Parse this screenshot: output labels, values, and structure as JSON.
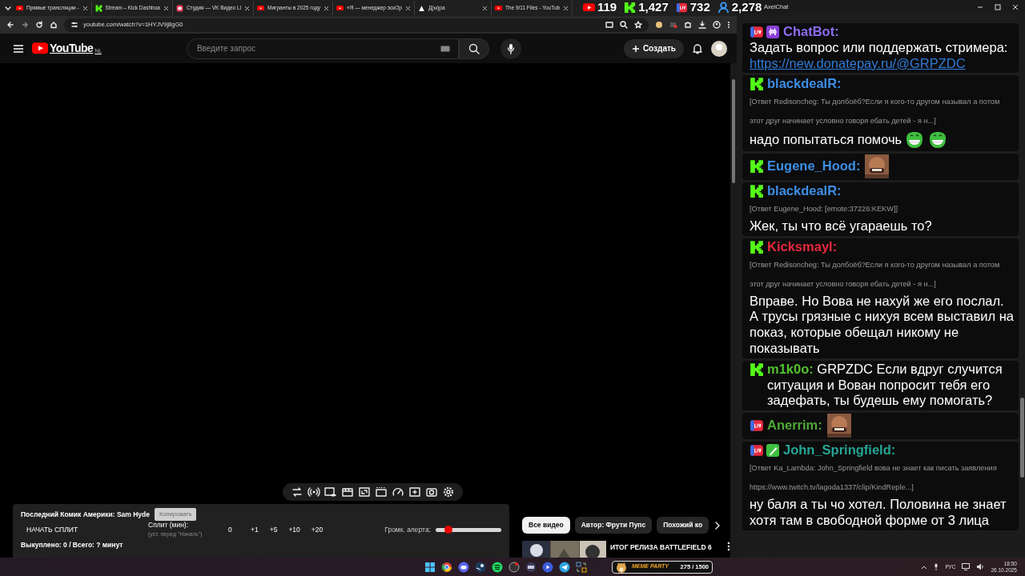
{
  "browser": {
    "tabs": [
      {
        "title": "Прямые трансляции -",
        "kind": "youtube"
      },
      {
        "title": "Stream – Kick Dashboa",
        "kind": "kick"
      },
      {
        "title": "Студия — VK Видео Li",
        "kind": "vk"
      },
      {
        "title": "Мигранты в 2025 году",
        "kind": "youtube"
      },
      {
        "title": "«Я — менеджер эскОр",
        "kind": "youtube"
      },
      {
        "title": "Д(ы)ра",
        "kind": "triangle"
      },
      {
        "title": "The 9/11 Files - YouTub",
        "kind": "youtube"
      }
    ],
    "address": "youtube.com/watch?v=1HYJV9j8gG0"
  },
  "stream_counters": [
    {
      "kind": "youtube",
      "value": "119"
    },
    {
      "kind": "kick",
      "value": "1,427"
    },
    {
      "kind": "live",
      "value": "732"
    },
    {
      "kind": "viewers",
      "value": "2,278"
    }
  ],
  "youtube": {
    "logo": "YouTube",
    "region": "NL",
    "search_placeholder": "Введите запрос",
    "create_button": "Создать"
  },
  "split_panel": {
    "title": "Последний Комик Америки: Sam Hyde",
    "copy_button": "Копировать",
    "copy_disabled": true,
    "start_button": "НАЧАТЬ СПЛИТ",
    "split_label": "Сплит (мин):",
    "split_hint": "(уст. перед \"Начать\")",
    "split_value": "0",
    "increments": [
      "+1",
      "+5",
      "+10",
      "+20"
    ],
    "volume_label": "Громк. алерта:",
    "volume": {
      "level": 0.2
    },
    "summary": "Выкуплено: 0 / Всего: ? минут"
  },
  "filter_chips": [
    {
      "label": "Все видео",
      "selected": true
    },
    {
      "label": "Автор: Фрути Пупс",
      "selected": false
    },
    {
      "label": "Похожий ко",
      "selected": false
    }
  ],
  "related_videos": [
    {
      "title": "ИТОГ РЕЛИЗА BATTLEFIELD 6"
    }
  ],
  "chat": {
    "title": "AxelChat",
    "messages": [
      {
        "platform": {
          "kind": "live"
        },
        "badges": [
          {
            "kind": "bot"
          }
        ],
        "author": "ChatBot:",
        "color": "#8b6cf2",
        "inline": false,
        "text": "Задать вопрос или поддержать стримера:",
        "link": "https://new.donatepay.ru/@GRPZDC"
      },
      {
        "platform": {
          "kind": "kick"
        },
        "author": "blackdealR:",
        "color": "#3d8ee6",
        "inline": false,
        "reply": "[Ответ Redisoncheg: Ты долбоёб?Если я кого-то другом называл а потом этот друг начинает условно говоря ебать детей - я н...]",
        "text": "надо попытаться помочь",
        "emotes": [
          {
            "kind": "grin"
          },
          {
            "kind": "grin"
          }
        ]
      },
      {
        "platform": {
          "kind": "kick"
        },
        "author": "Eugene_Hood:",
        "color": "#3d8ee6",
        "inline": false
      },
      {
        "platform": {
          "kind": "kick"
        },
        "author": "blackdealR:",
        "color": "#3d8ee6",
        "inline": false,
        "reply": "[Ответ Eugene_Hood: [emote:37226:KEKW]]",
        "text": "Жек, ты что всё угараешь то?"
      },
      {
        "platform": {
          "kind": "kick"
        },
        "author": "Kicksmayl:",
        "color": "#e8283c",
        "inline": false,
        "reply": "[Ответ Redisoncheg: Ты долбоёб?Если я кого-то другом называл а потом этот друг начинает условно говоря ебать детей - я н...]",
        "text": "Вправе. Но Вова не нахуй же его послал. А трусы грязные с нихуя всем выставил на показ, которые обещал никому не показывать"
      },
      {
        "platform": {
          "kind": "kick"
        },
        "author": "m1k0o:",
        "color": "#53c22f",
        "inline": true,
        "text": "GRPZDC Если вдруг случится ситуация и Вован попросит тебя его задефать, ты будешь ему помогать?"
      },
      {
        "platform": {
          "kind": "live"
        },
        "author": "Anerrim:",
        "color": "#4fa838",
        "inline": false
      },
      {
        "platform": {
          "kind": "live"
        },
        "badges": [
          {
            "kind": "pen"
          }
        ],
        "author": "John_Springfield:",
        "color": "#26a597",
        "inline": false,
        "reply": "[Ответ Ka_Lambda: John_Springfield вова не знает как писать заявления https://www.twitch.tv/lagoda1337/clip/KindReple...]",
        "text": "ну баля а ты чо хотел. Половина не знает хотя там в свободной форме от 3 лица"
      }
    ]
  },
  "taskbar": {
    "widget": {
      "title": "MEME PARTY",
      "progress": "275 / 1500"
    },
    "language": "РУС",
    "time": "18:50",
    "date": "26.10.2025"
  }
}
